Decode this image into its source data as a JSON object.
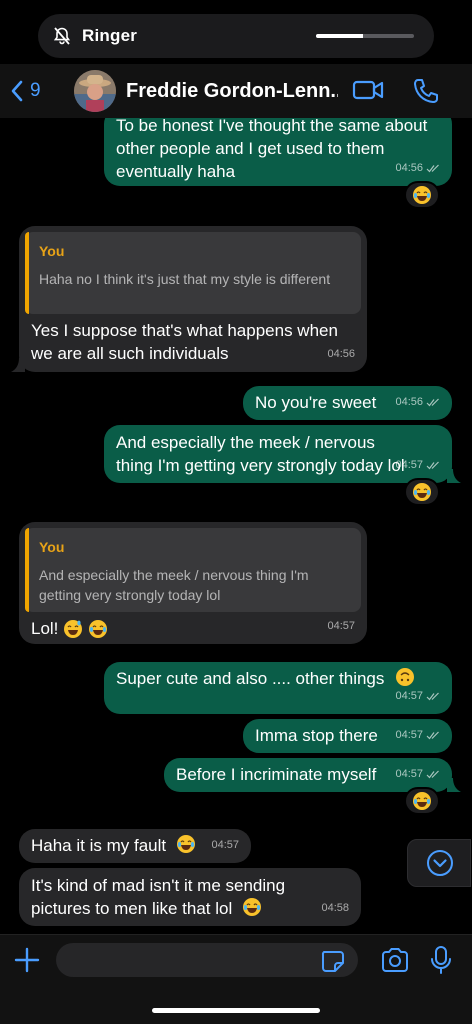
{
  "status": {
    "ringer_label": "Ringer",
    "ringer_level": 0.48
  },
  "header": {
    "back_count": "9",
    "contact_name": "Freddie Gordon-Lenn..."
  },
  "messages": [
    {
      "dir": "out",
      "text_lines": [
        "To be honest I've thought the same about",
        "other people and I get used to them",
        "eventually haha"
      ],
      "time": "04:56",
      "reaction": "laughing-emoji"
    },
    {
      "dir": "in",
      "quote": {
        "name": "You",
        "text": "Haha no I think it's just that my style is different"
      },
      "text": "Yes I suppose that's what happens when we are all such individuals",
      "time": "04:56"
    },
    {
      "dir": "out",
      "text": "No you're sweet",
      "time": "04:56"
    },
    {
      "dir": "out",
      "text": "And especially the meek / nervous thing I'm getting very strongly today lol",
      "time": "04:57",
      "reaction": "laughing-emoji"
    },
    {
      "dir": "in",
      "quote": {
        "name": "You",
        "text": "And especially the meek / nervous thing I'm getting very strongly today lol"
      },
      "text": "Lol!",
      "time": "04:57"
    },
    {
      "dir": "out",
      "text": "Super cute and also .... other things",
      "time": "04:57"
    },
    {
      "dir": "out",
      "text": "Imma stop there",
      "time": "04:57"
    },
    {
      "dir": "out",
      "text": "Before I incriminate myself",
      "time": "04:57",
      "reaction": "laughing-emoji"
    },
    {
      "dir": "in",
      "text": "Haha it is my fault",
      "time": "04:57"
    },
    {
      "dir": "in",
      "text": "It's kind of mad isn't it me sending pictures to men like that lol",
      "time": "04:58"
    }
  ],
  "colors": {
    "outgoing_bubble": "#0a5d48",
    "incoming_bubble": "#272729",
    "accent": "#4a9dff",
    "quote_name": "#e8a317"
  },
  "icons": [
    "bell-slash-icon",
    "chevron-left-icon",
    "video-icon",
    "phone-icon",
    "chevron-down-icon",
    "plus-icon",
    "sticker-icon",
    "camera-icon",
    "microphone-icon"
  ]
}
